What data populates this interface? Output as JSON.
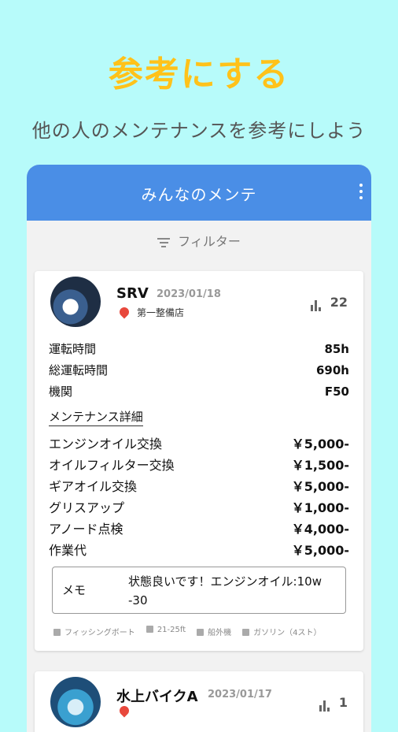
{
  "promo": {
    "headline": "参考にする",
    "subline": "他の人のメンテナンスを参考にしよう"
  },
  "appbar": {
    "title": "みんなのメンテ"
  },
  "filter": {
    "label": "フィルター"
  },
  "cards": [
    {
      "model": "SRV",
      "date": "2023/01/18",
      "shop": "第一整備店",
      "likes": "22",
      "stats": [
        {
          "label": "運転時間",
          "value": "85h"
        },
        {
          "label": "総運転時間",
          "value": "690h"
        },
        {
          "label": "機関",
          "value": "F50"
        }
      ],
      "section_title": "メンテナンス詳細",
      "items": [
        {
          "label": "エンジンオイル交換",
          "value": "￥5,000-"
        },
        {
          "label": "オイルフィルター交換",
          "value": "￥1,500-"
        },
        {
          "label": "ギアオイル交換",
          "value": "￥5,000-"
        },
        {
          "label": "グリスアップ",
          "value": "￥1,000-"
        },
        {
          "label": "アノード点検",
          "value": "￥4,000-"
        },
        {
          "label": "作業代",
          "value": "￥5,000-"
        }
      ],
      "memo_label": "メモ",
      "memo": "状態良いです！エンジンオイル:10w-30",
      "meta": {
        "boat_type": "フィッシングボート",
        "size": "21-25ft",
        "engine_type": "船外機",
        "fuel": "ガソリン（4スト）"
      }
    },
    {
      "model": "水上バイクA",
      "date": "2023/01/17",
      "likes": "1"
    }
  ]
}
